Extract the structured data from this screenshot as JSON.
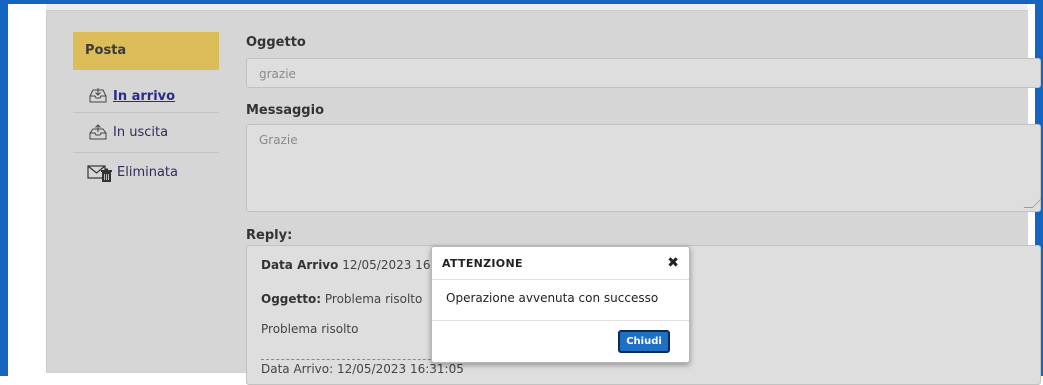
{
  "sidebar": {
    "header": "Posta",
    "items": [
      {
        "label": "In arrivo",
        "icon": "inbox-icon",
        "active": true
      },
      {
        "label": "In uscita",
        "icon": "outbox-icon",
        "active": false
      },
      {
        "label": "Eliminata",
        "icon": "trash-mail-icon",
        "active": false
      }
    ]
  },
  "form": {
    "subject_label": "Oggetto",
    "subject_value": "grazie",
    "message_label": "Messaggio",
    "message_value": "Grazie",
    "reply_label": "Reply:"
  },
  "reply": {
    "date_label": "Data Arrivo",
    "date_value": "12/05/2023 16",
    "subject_label": "Oggetto:",
    "subject_value": "Problema risolto",
    "body": "Problema risolto",
    "footer_line": "Data Arrivo: 12/05/2023 16:31:05"
  },
  "modal": {
    "title": "ATTENZIONE",
    "close_glyph": "✖",
    "message": "Operazione avvenuta con successo",
    "button_label": "Chiudi"
  },
  "colors": {
    "frame": "#1565c0",
    "sidebar_header": "#dcbd59",
    "button": "#1f6fc4"
  }
}
